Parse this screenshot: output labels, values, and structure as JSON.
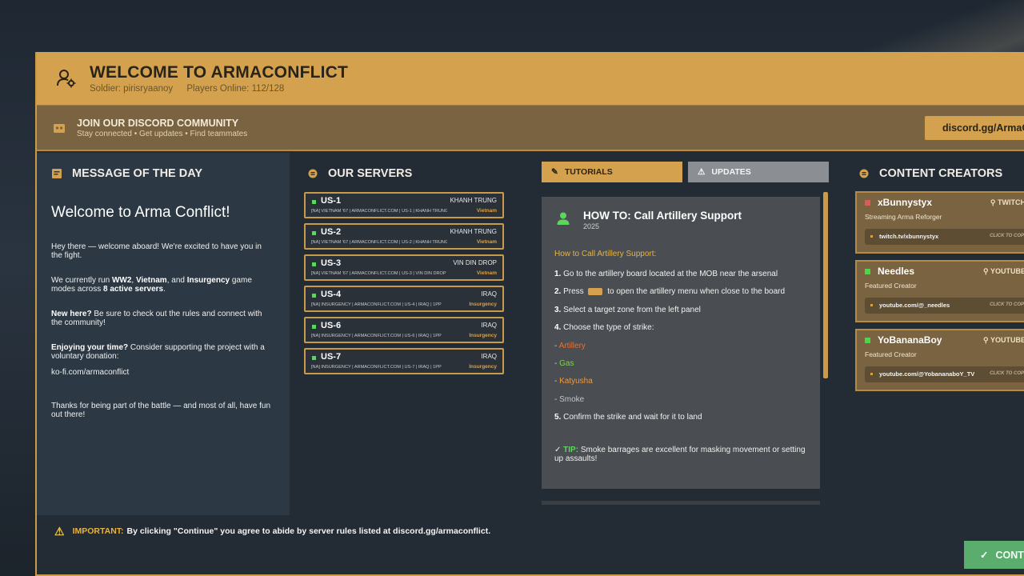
{
  "header": {
    "title": "WELCOME TO ARMACONFLICT",
    "soldier": "Soldier: pirisryaanoy",
    "players": "Players Online: 112/128"
  },
  "discord": {
    "title": "JOIN OUR DISCORD COMMUNITY",
    "subtitle": "Stay connected • Get updates • Find teammates",
    "button": "discord.gg/ArmaConflict"
  },
  "motd": {
    "heading": "MESSAGE OF THE DAY",
    "welcome": "Welcome to Arma Conflict!",
    "p1": "Hey there — welcome aboard! We're excited to have you in the fight.",
    "p2_a": "We currently run ",
    "p2_ww2": "WW2",
    "p2_b": ", ",
    "p2_vietnam": "Vietnam",
    "p2_c": ", and ",
    "p2_insurgency": "Insurgency",
    "p2_d": " game modes across ",
    "p2_servers": "8 active servers",
    "p2_e": ".",
    "p3_bold": "New here?",
    "p3_rest": " Be sure to check out the rules and connect with the community!",
    "p4_bold": "Enjoying your time?",
    "p4_rest": " Consider supporting the project with a voluntary donation:",
    "p5": "ko-fi.com/armaconflict",
    "p6": "Thanks for being part of the battle — and most of all, have fun out there!"
  },
  "servers": {
    "heading": "OUR SERVERS",
    "items": [
      {
        "name": "US-1",
        "map": "KHANH TRUNG",
        "desc": "[NA] VIETNAM '67 | ARMACONFLICT.COM | US-1 | KHANH TRUNG",
        "mode": "Vietnam"
      },
      {
        "name": "US-2",
        "map": "KHANH TRUNG",
        "desc": "[NA] VIETNAM '67 | ARMACONFLICT.COM | US-2 | KHANH TRUNG",
        "mode": "Vietnam"
      },
      {
        "name": "US-3",
        "map": "VIN DIN DROP",
        "desc": "[NA] VIETNAM '67 | ARMACONFLICT.COM | US-3 | VIN DIN DROP",
        "mode": "Vietnam"
      },
      {
        "name": "US-4",
        "map": "IRAQ",
        "desc": "[NA] INSURGENCY | ARMACONFLICT.COM | US-4 | IRAQ | 1PP",
        "mode": "Insurgency"
      },
      {
        "name": "US-6",
        "map": "IRAQ",
        "desc": "[NA] INSURGENCY | ARMACONFLICT.COM | US-6 | IRAQ | 1PP",
        "mode": "Insurgency"
      },
      {
        "name": "US-7",
        "map": "IRAQ",
        "desc": "[NA] INSURGENCY | ARMACONFLICT.COM | US-7 | IRAQ | 1PP",
        "mode": "Insurgency"
      }
    ]
  },
  "tabs": {
    "tutorials": "TUTORIALS",
    "updates": "UPDATES"
  },
  "tutorial": {
    "title": "HOW TO: Call Artillery Support",
    "year": "2025",
    "intro": "How to Call Artillery Support:",
    "s1_num": "1.",
    "s1": " Go to the artillery board located at the MOB near the arsenal",
    "s2_num": "2.",
    "s2_a": " Press ",
    "s2_b": " to open the artillery menu when close to the board",
    "s3_num": "3.",
    "s3": " Select a target zone from the left panel",
    "s4_num": "4.",
    "s4": " Choose the type of strike:",
    "strike_prefix": "- ",
    "strike_artillery": "Artillery",
    "strike_gas": "Gas",
    "strike_katyusha": "Katyusha",
    "strike_smoke": "Smoke",
    "s5_num": "5.",
    "s5": " Confirm the strike and wait for it to land",
    "tip_check": "✓ ",
    "tip_label": "TIP:",
    "tip_text": " Smoke barrages are excellent for masking movement or setting up assaults!"
  },
  "creators": {
    "heading": "CONTENT CREATORS",
    "items": [
      {
        "name": "xBunnystyx",
        "platform": "TWITCH",
        "sub": "Streaming Arma Reforger",
        "link": "twitch.tv/xbunnystyx",
        "cta": "CLICK TO COPY",
        "status_color": "#e05a5a"
      },
      {
        "name": "Needles",
        "platform": "YOUTUBE",
        "sub": "Featured Creator",
        "link": "youtube.com/@_needles",
        "cta": "CLICK TO COPY",
        "status_color": "#4cd64c"
      },
      {
        "name": "YoBananaBoy",
        "platform": "YOUTUBE",
        "sub": "Featured Creator",
        "link": "youtube.com/@YobananaboY_TV",
        "cta": "CLICK TO COPY",
        "status_color": "#4cd64c"
      }
    ]
  },
  "footer": {
    "important_label": "IMPORTANT:",
    "important_text": "By clicking \"Continue\" you agree to abide by server rules listed at discord.gg/armaconflict.",
    "continue": "CONTINUE"
  },
  "colors": {
    "accent_gold": "#d4a24f",
    "panel_brown": "#7a6340",
    "online_green": "#5cd65c",
    "continue_green": "#5aad6c"
  }
}
